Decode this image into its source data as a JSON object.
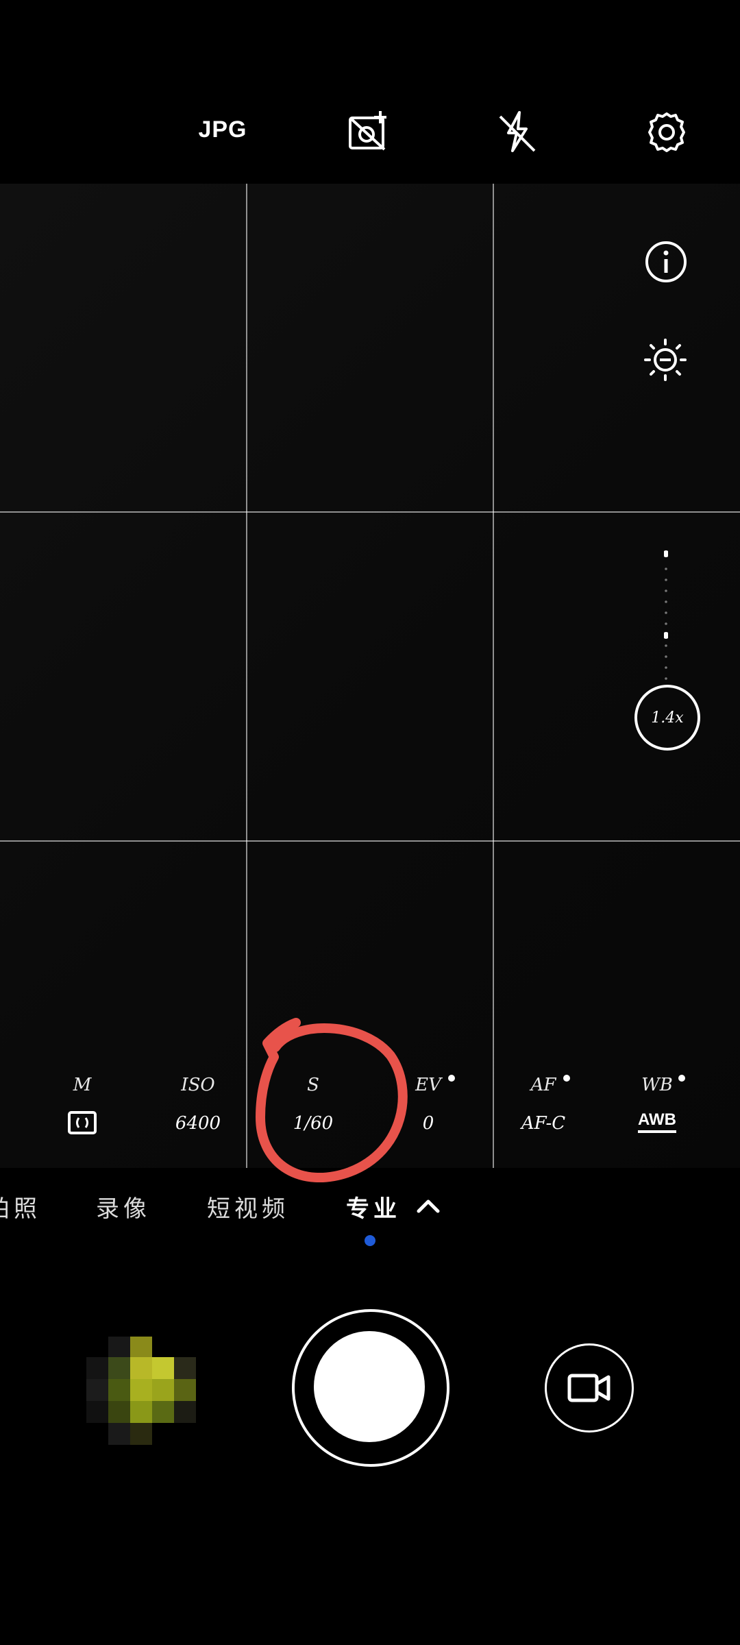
{
  "topbar": {
    "format_label": "JPG",
    "icons": [
      "live-photo-off-icon",
      "flash-off-icon",
      "settings-icon"
    ]
  },
  "side_controls": {
    "icons": [
      "info-icon",
      "exposure-icon"
    ],
    "zoom_level": "1.4x"
  },
  "pro_params": [
    {
      "label": "M",
      "value": "metering-icon",
      "has_dot": false
    },
    {
      "label": "ISO",
      "value": "6400",
      "has_dot": false
    },
    {
      "label": "S",
      "value": "1/60",
      "has_dot": false
    },
    {
      "label": "EV",
      "value": "0",
      "has_dot": true
    },
    {
      "label": "AF",
      "value": "AF-C",
      "has_dot": true
    },
    {
      "label": "WB",
      "value": "AWB",
      "has_dot": true
    }
  ],
  "modes": {
    "items": [
      "拍照",
      "录像",
      "短视频",
      "专业"
    ],
    "active": "专业"
  },
  "colors": {
    "annotation": "#e8534b",
    "mode_indicator": "#1f5bd8",
    "background": "#000000"
  },
  "bottom": {
    "icons": [
      "gallery-thumbnail",
      "shutter-button",
      "video-camera-icon"
    ]
  }
}
